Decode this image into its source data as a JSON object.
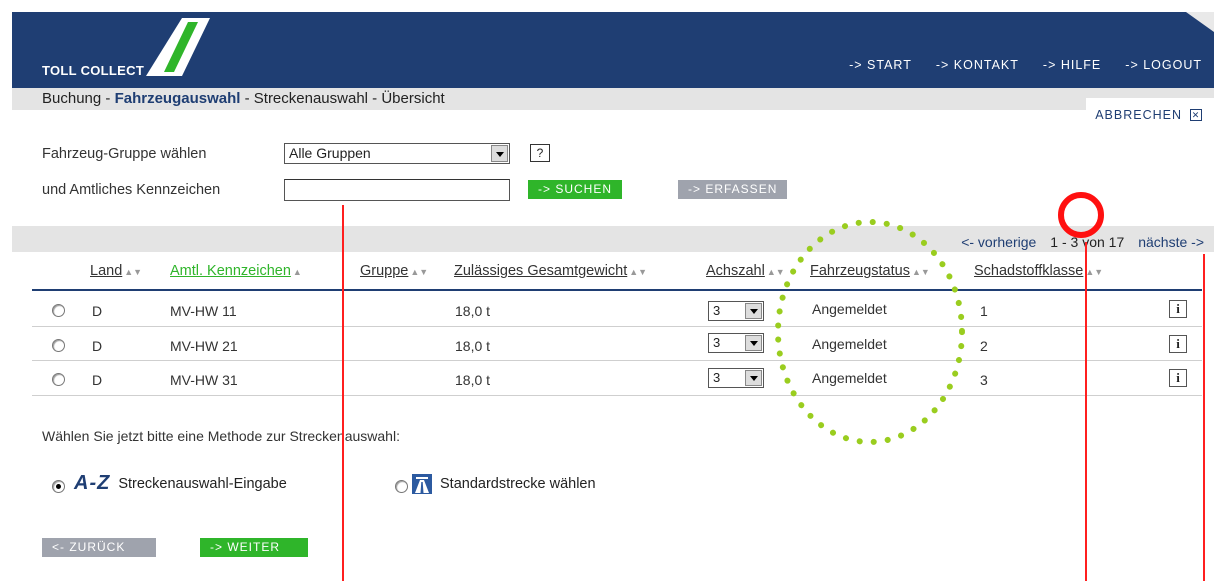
{
  "header": {
    "logo": "TOLL COLLECT",
    "nav": [
      "-> START",
      "-> KONTAKT",
      "-> HILFE",
      "-> LOGOUT"
    ]
  },
  "breadcrumb": {
    "items": [
      "Buchung",
      "Fahrzeugauswahl",
      "Streckenauswahl",
      "Übersicht"
    ],
    "separator": " - ",
    "active_index": 1
  },
  "cancel": {
    "label": "ABBRECHEN",
    "icon": "close-box-icon"
  },
  "form": {
    "group_label": "Fahrzeug-Gruppe wählen",
    "group_value": "Alle Gruppen",
    "help_label": "?",
    "plate_label": "und Amtliches Kennzeichen",
    "plate_value": "",
    "search_button": "-> SUCHEN",
    "register_button": "-> ERFASSEN"
  },
  "pager": {
    "prev": "<-   vorherige",
    "range": "1 - 3 von 17",
    "next": "nächste ->"
  },
  "table": {
    "columns": [
      "Land",
      "Amtl. Kennzeichen",
      "Gruppe",
      "Zulässiges Gesamtgewicht",
      "Achszahl",
      "Fahrzeugstatus",
      "Schadstoffklasse"
    ],
    "sorted_column": "Amtl. Kennzeichen",
    "rows": [
      {
        "land": "D",
        "plate": "MV-HW 11",
        "group": "",
        "weight": "18,0 t",
        "axles": "3",
        "status": "Angemeldet",
        "emission": "1"
      },
      {
        "land": "D",
        "plate": "MV-HW 21",
        "group": "",
        "weight": "18,0 t",
        "axles": "3",
        "status": "Angemeldet",
        "emission": "2"
      },
      {
        "land": "D",
        "plate": "MV-HW 31",
        "group": "",
        "weight": "18,0 t",
        "axles": "3",
        "status": "Angemeldet",
        "emission": "3"
      }
    ],
    "info_glyph": "i"
  },
  "route": {
    "prompt": "Wählen Sie jetzt bitte eine Methode zur Streckenauswahl:",
    "option1_badge": "A-Z",
    "option1_label": "Streckenauswahl-Eingabe",
    "option2_label": "Standardstrecke wählen"
  },
  "footer": {
    "back": "<- ZURÜCK",
    "next": "-> WEITER"
  },
  "colors": {
    "brand_blue": "#1f3e73",
    "green": "#2fb52a",
    "annotation_red": "#ff1010",
    "annotation_dots": "#9acd1f"
  }
}
